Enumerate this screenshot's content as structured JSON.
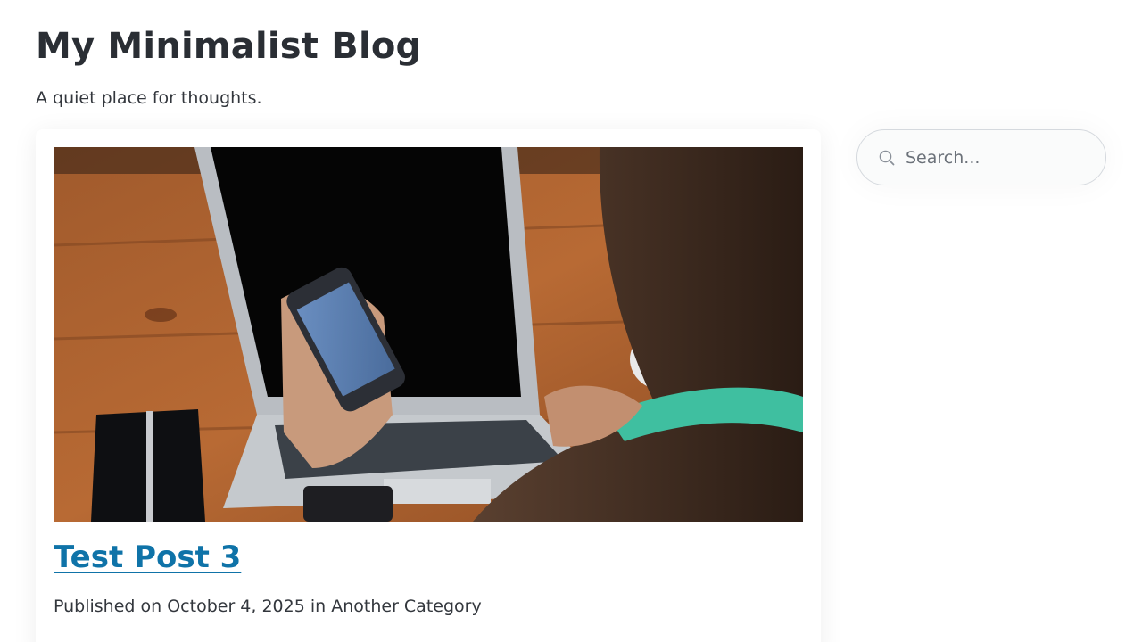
{
  "site": {
    "title": "My Minimalist Blog",
    "tagline": "A quiet place for thoughts."
  },
  "search": {
    "placeholder": "Search...",
    "value": "",
    "icon": "search-icon"
  },
  "post": {
    "title": "Test Post 3",
    "meta": "Published on October 4, 2025 in Another Category",
    "image_alt": "Person holding a smartphone in front of a laptop on a wooden desk"
  },
  "colors": {
    "link": "#0f73a8",
    "text": "#2c3036",
    "border": "#d5d9de"
  }
}
